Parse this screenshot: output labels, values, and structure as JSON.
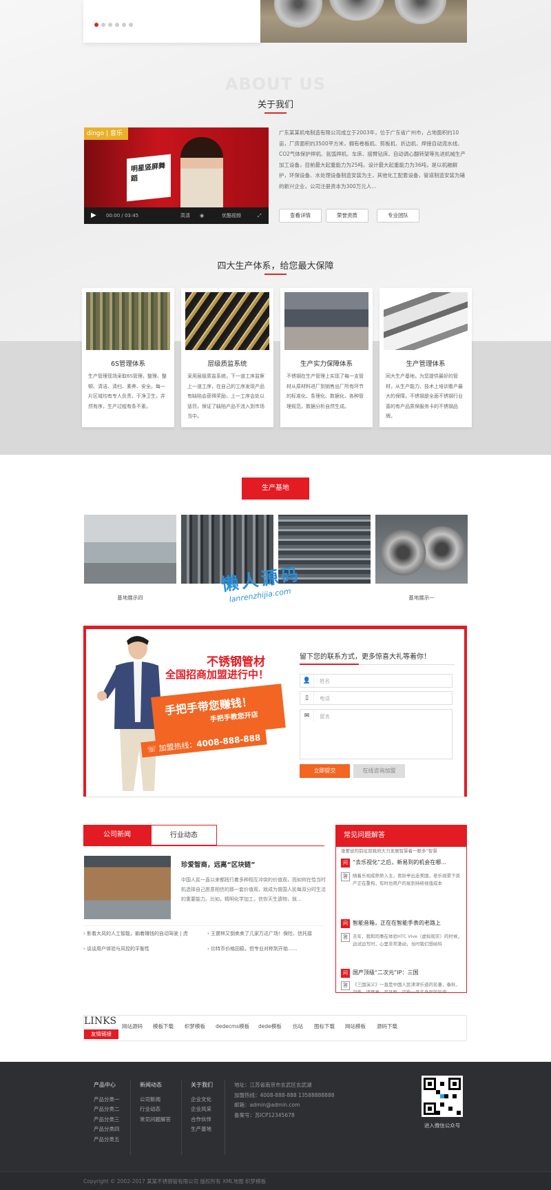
{
  "about": {
    "title_en": "ABOUT US",
    "title_cn": "关于我们",
    "text": "广东某某机电制造有限公司成立于2003年，位于广东省广州市，占地面积约10亩，厂房面积约3500平方米，拥有卷板机、剪板机、折边机、焊接自动流水线、CO2气体保护焊机、氩弧焊机、车床、摇臂钻床、自动调心翻转架等先进机械生产加工设备，目前最大起重能力为25吨，设计最大起重能力为36吨，是以机融解护，环保设备、水处理设备制造安装为主，其他化工配套设备，管道制造安装为辅的新兴企业，公司注册资本为300万元人...",
    "video_brand": "dingo | 音乐",
    "video_sign": "明星竖屏舞蹈",
    "video_time": "00:00 / 03:45",
    "video_quality": "高清",
    "video_site": "优酷视频",
    "buttons": [
      "查看详情",
      "荣誉资质",
      "专业团队"
    ]
  },
  "system": {
    "title": "四大生产体系，给您最大保障",
    "cards": [
      {
        "title": "6S管理体系",
        "text": "生产管理现场采取6S管理，整理、整顿、清洁、清扫、素养、安全。每一片区域均有专人负责，干净卫生，井然有序，生产过程有条不紊。"
      },
      {
        "title": "层级质监系统",
        "text": "采用层级质监系统，下一道工序监察上一道工序，在自己的工序发现产品有缺陷会获得奖励，上一工序会处以惩罚，保证了缺陷产品不流入到市场当中。"
      },
      {
        "title": "生产实力保障体系",
        "text": "不锈钢在生产管理上实现了每一支管材从原材料进厂到销售出厂所有环节的标准化、条理化、数据化，各种管理规范，数据分析自然生成。"
      },
      {
        "title": "生产管理体系",
        "text": "同大生产基地，为您提供最好的管材，从生产能力、技术上培训看产最大的保障。不锈钢是全面不锈钢行业喜的有产品质保服务卡的不锈钢品牌。"
      }
    ]
  },
  "base": {
    "button": "生产基地",
    "captions": [
      "基地展示四",
      "",
      "",
      "基地展示一"
    ]
  },
  "watermark": {
    "cn": "懒人源码",
    "en": "lanrenzhijia.com"
  },
  "promo": {
    "line1": "不锈钢管材",
    "line2": "全国招商加盟进行中！",
    "banner1": "手把手带您赚钱！",
    "banner2": "手把手教您开店",
    "hotline_label": "加盟热线：",
    "hotline": "4008-888-888",
    "form_title": "留下您的联系方式，更多惊喜大礼等着你！",
    "name_placeholder": "姓名",
    "phone_placeholder": "电话",
    "message_placeholder": "留言",
    "submit": "立即提交",
    "consult": "在线咨询加盟"
  },
  "news": {
    "tabs": [
      "公司新闻",
      "行业动态"
    ],
    "headline": "珍爱智商，远离“区块链”",
    "summary": "中国人民一直以来都践行着多种相互冲突的价值观，而如何在恰当时机选择自己愿意相信的那一套价值观，就成为普国人民每双分时生活的重要能力。比如，精明化学加工，信你天生遗物，就...",
    "items": [
      "影看大风的人工智能，躺着赚钱的自动驾驶 | 虎",
      "王健林又倒卖卖了几家万达广场！保险、信托接",
      "谈谈用户体验与风控的平衡性",
      "比特币价格回稳，但专业对称到开始......"
    ]
  },
  "faq": {
    "title": "常见问题解答",
    "q_tag": "问",
    "a_tag": "答",
    "top_fragment": "谁要说的前往双政府大力发展智慧着一眼多“智慧",
    "items": [
      {
        "q": "“去乐视化”之后，新易到的机会在哪...",
        "a": "随着乐视成熟势入主，贾跃亭出走美国，老乐视渠下资产正在重构，有时也用户的易到持续视值成本"
      },
      {
        "q": "智能音箱，正在在智能手表的老路上",
        "a": "去年，我和同事在体验HTC Vive（虚拟现实）的时候，边试边写时，心里非常激动，当时我们想给科"
      },
      {
        "q": "国产顶级“二次元”IP：三国",
        "a": "《三国演义》一直是中国人民津津乐道的名著，春秋、刘备、诸葛亮、司马懿，这些一开名身就的历史"
      }
    ]
  },
  "links": {
    "en": "LINKS",
    "cn": "友情链接",
    "items": [
      "网站源码",
      "模板下载",
      "织梦模板",
      "dedecms模板",
      "dede模板",
      "仿站",
      "图标下载",
      "网站模板",
      "源码下载"
    ]
  },
  "footer": {
    "cols": [
      {
        "title": "产品中心",
        "items": [
          "产品分类一",
          "产品分类二",
          "产品分类三",
          "产品分类四",
          "产品分类五"
        ]
      },
      {
        "title": "新闻动态",
        "items": [
          "公司新闻",
          "行业动态",
          "常见问题解答"
        ]
      },
      {
        "title": "关于我们",
        "items": [
          "企业文化",
          "企业风采",
          "合作伙伴",
          "生产基地"
        ]
      }
    ],
    "address": "地址：江苏省南京市玄武区玄武湖",
    "hotline": "加盟热线：4008-888-888     13588888888",
    "email": "邮箱：admin@admin.com",
    "icp": "备案号：苏ICP12345678",
    "qr_caption": "进入微信公众号",
    "copyright": "Copyright © 2002-2017 某某不锈钢管有限公司 版权所有   XML地图   织梦模板"
  }
}
